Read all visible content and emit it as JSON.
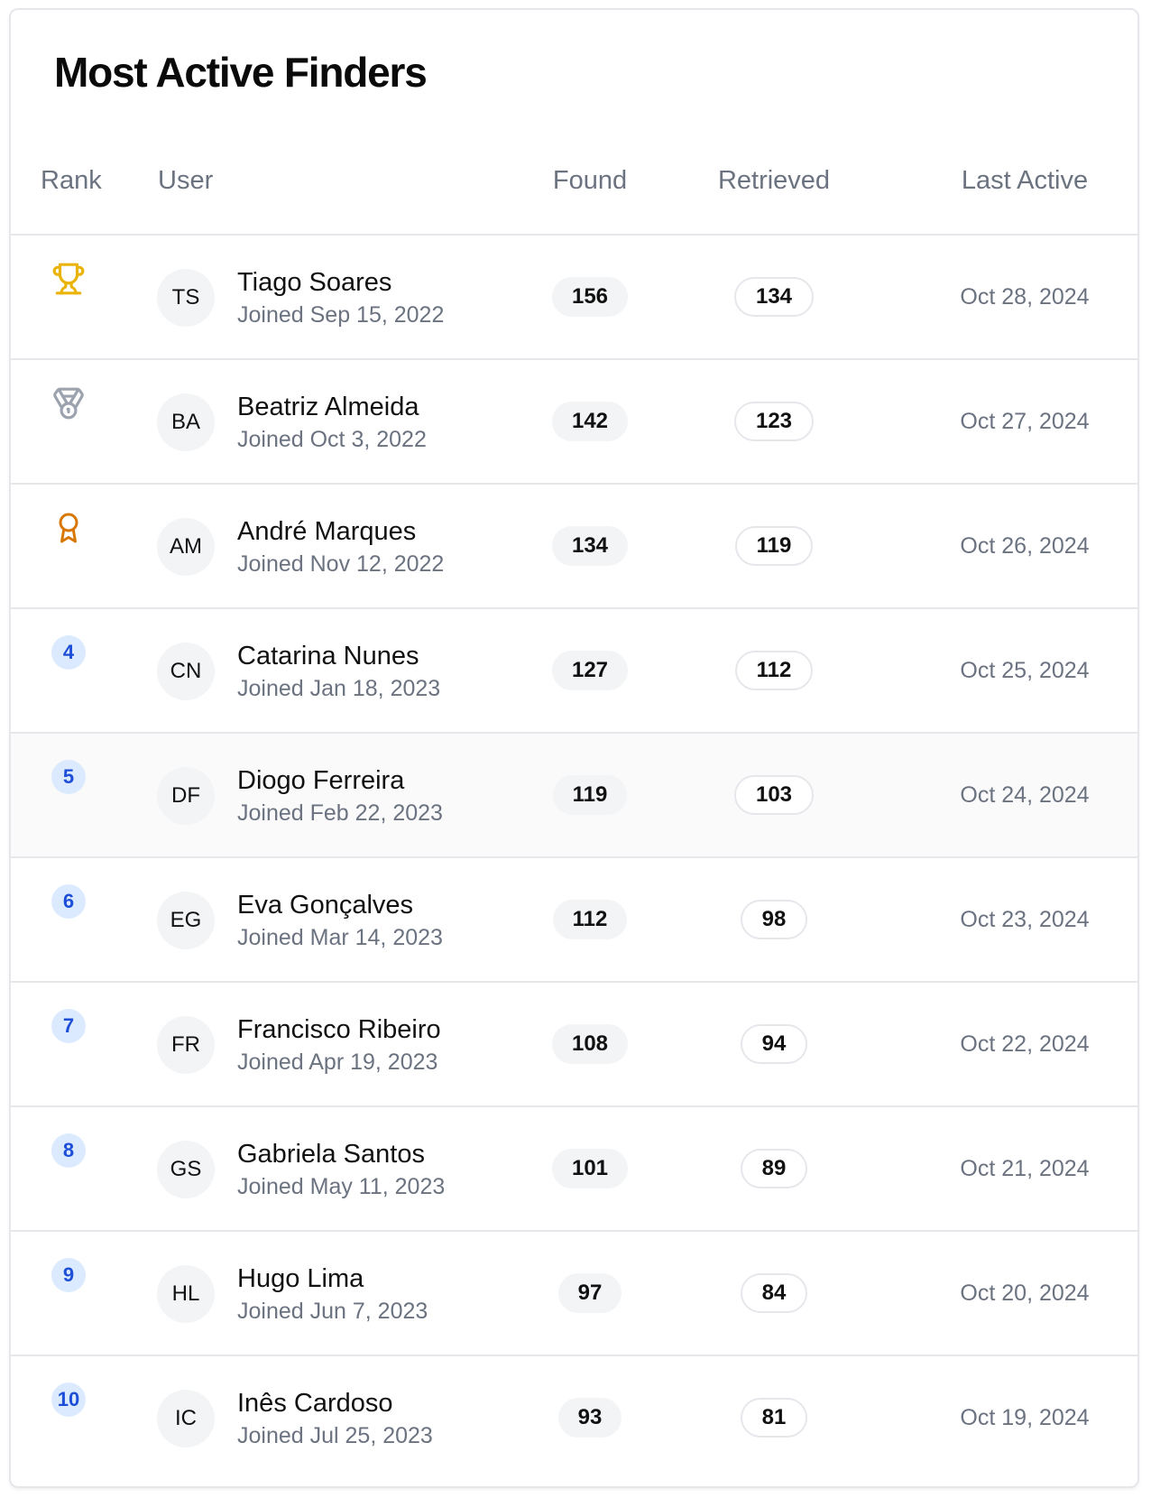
{
  "title": "Most Active Finders",
  "columns": {
    "rank": "Rank",
    "user": "User",
    "found": "Found",
    "retrieved": "Retrieved",
    "last_active": "Last Active"
  },
  "colors": {
    "gold": "#eab308",
    "silver": "#9ca3af",
    "bronze": "#d97706",
    "rank_badge_bg": "#dbeafe",
    "rank_badge_text": "#1d4ed8"
  },
  "rows": [
    {
      "rank": "1",
      "rank_icon": "trophy-icon",
      "initials": "TS",
      "name": "Tiago Soares",
      "joined": "Joined Sep 15, 2022",
      "found": "156",
      "retrieved": "134",
      "last_active": "Oct 28, 2024"
    },
    {
      "rank": "2",
      "rank_icon": "medal-icon",
      "initials": "BA",
      "name": "Beatriz Almeida",
      "joined": "Joined Oct 3, 2022",
      "found": "142",
      "retrieved": "123",
      "last_active": "Oct 27, 2024"
    },
    {
      "rank": "3",
      "rank_icon": "award-icon",
      "initials": "AM",
      "name": "André Marques",
      "joined": "Joined Nov 12, 2022",
      "found": "134",
      "retrieved": "119",
      "last_active": "Oct 26, 2024"
    },
    {
      "rank": "4",
      "initials": "CN",
      "name": "Catarina Nunes",
      "joined": "Joined Jan 18, 2023",
      "found": "127",
      "retrieved": "112",
      "last_active": "Oct 25, 2024"
    },
    {
      "rank": "5",
      "initials": "DF",
      "name": "Diogo Ferreira",
      "joined": "Joined Feb 22, 2023",
      "found": "119",
      "retrieved": "103",
      "last_active": "Oct 24, 2024"
    },
    {
      "rank": "6",
      "initials": "EG",
      "name": "Eva Gonçalves",
      "joined": "Joined Mar 14, 2023",
      "found": "112",
      "retrieved": "98",
      "last_active": "Oct 23, 2024"
    },
    {
      "rank": "7",
      "initials": "FR",
      "name": "Francisco Ribeiro",
      "joined": "Joined Apr 19, 2023",
      "found": "108",
      "retrieved": "94",
      "last_active": "Oct 22, 2024"
    },
    {
      "rank": "8",
      "initials": "GS",
      "name": "Gabriela Santos",
      "joined": "Joined May 11, 2023",
      "found": "101",
      "retrieved": "89",
      "last_active": "Oct 21, 2024"
    },
    {
      "rank": "9",
      "initials": "HL",
      "name": "Hugo Lima",
      "joined": "Joined Jun 7, 2023",
      "found": "97",
      "retrieved": "84",
      "last_active": "Oct 20, 2024"
    },
    {
      "rank": "10",
      "initials": "IC",
      "name": "Inês Cardoso",
      "joined": "Joined Jul 25, 2023",
      "found": "93",
      "retrieved": "81",
      "last_active": "Oct 19, 2024"
    }
  ]
}
